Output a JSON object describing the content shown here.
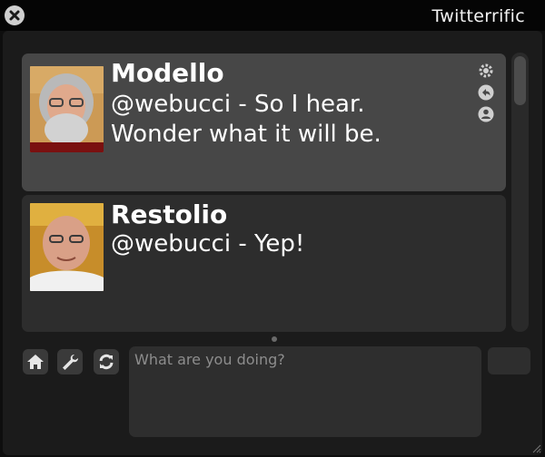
{
  "window": {
    "title": "Twitterrific"
  },
  "tweets": [
    {
      "name": "Modello",
      "text": "@webucci - So I hear. Wonder what it will be."
    },
    {
      "name": "Restolio",
      "text": "@webucci - Yep!"
    }
  ],
  "compose": {
    "placeholder": "What are you doing?"
  },
  "icons": {
    "close": "close-icon",
    "tweet_actions": [
      "gear-icon",
      "reply-icon",
      "user-icon"
    ],
    "toolbar": [
      "home-icon",
      "wrench-icon",
      "refresh-icon"
    ]
  },
  "colors": {
    "background": "#0e0e0e",
    "selected_tweet": "#474747",
    "tweet": "#2d2d2d",
    "text": "#ffffff"
  }
}
